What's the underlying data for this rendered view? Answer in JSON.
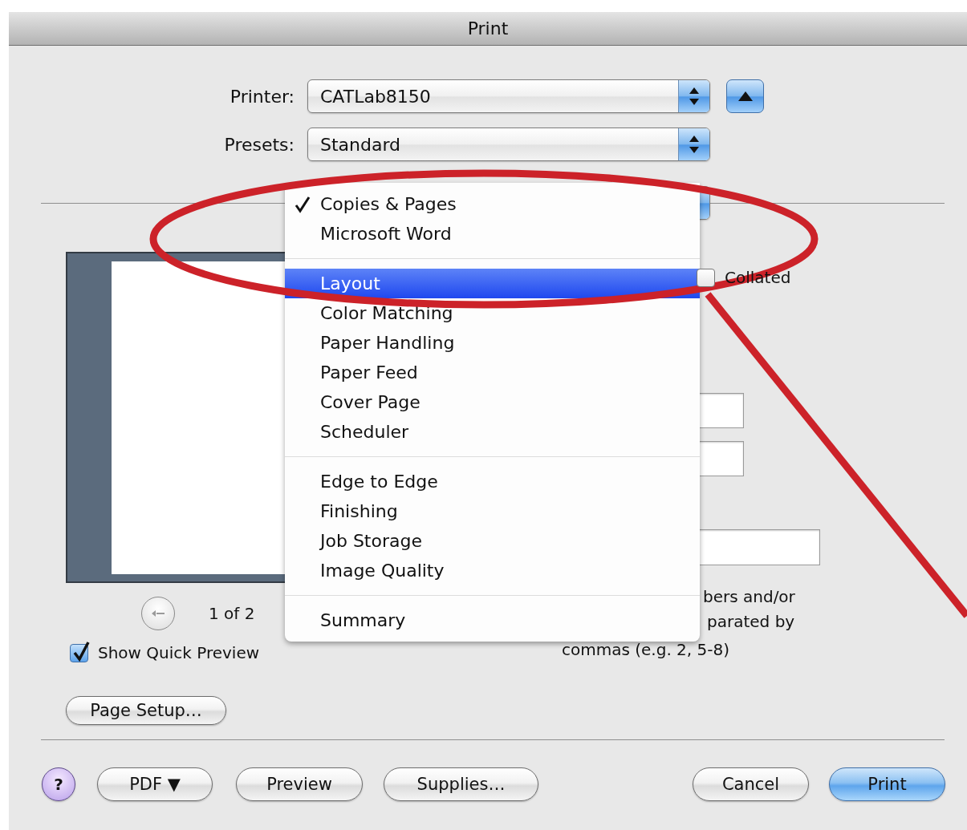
{
  "window": {
    "title": "Print"
  },
  "printer": {
    "label": "Printer:",
    "value": "CATLab8150"
  },
  "presets": {
    "label": "Presets:",
    "value": "Standard"
  },
  "panel_menu": {
    "groups": [
      [
        {
          "label": "Copies & Pages",
          "checked": true,
          "selected": false
        },
        {
          "label": "Microsoft Word",
          "checked": false,
          "selected": false
        }
      ],
      [
        {
          "label": "Layout",
          "checked": false,
          "selected": true
        },
        {
          "label": "Color Matching",
          "checked": false,
          "selected": false
        },
        {
          "label": "Paper Handling",
          "checked": false,
          "selected": false
        },
        {
          "label": "Paper Feed",
          "checked": false,
          "selected": false
        },
        {
          "label": "Cover Page",
          "checked": false,
          "selected": false
        },
        {
          "label": "Scheduler",
          "checked": false,
          "selected": false
        }
      ],
      [
        {
          "label": "Edge to Edge",
          "checked": false,
          "selected": false
        },
        {
          "label": "Finishing",
          "checked": false,
          "selected": false
        },
        {
          "label": "Job Storage",
          "checked": false,
          "selected": false
        },
        {
          "label": "Image Quality",
          "checked": false,
          "selected": false
        }
      ],
      [
        {
          "label": "Summary",
          "checked": false,
          "selected": false
        }
      ]
    ]
  },
  "preview": {
    "page_indicator": "1 of 2",
    "show_quick_preview": {
      "label": "Show Quick Preview",
      "checked": true
    },
    "page_setup_button": "Page Setup…"
  },
  "copies": {
    "collated": {
      "label": "Collated",
      "checked": false
    }
  },
  "page_range_hint": [
    "bers and/or",
    "parated by",
    "commas (e.g. 2, 5-8)"
  ],
  "buttons": {
    "help": "?",
    "left": [
      "PDF ▼",
      "Preview",
      "Supplies…"
    ],
    "right": [
      {
        "label": "Cancel",
        "default": false
      },
      {
        "label": "Print",
        "default": true
      }
    ]
  }
}
